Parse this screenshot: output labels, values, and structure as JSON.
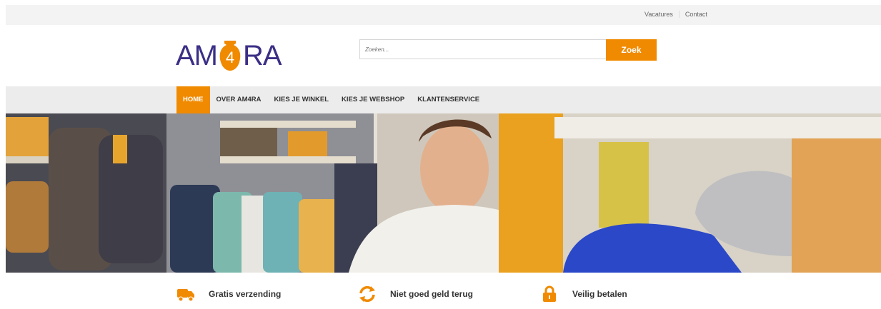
{
  "topbar": {
    "links": [
      "Vacatures",
      "Contact"
    ]
  },
  "logo": {
    "left": "AM",
    "mid": "4",
    "right": "RA"
  },
  "search": {
    "placeholder": "Zoeken...",
    "button": "Zoek"
  },
  "nav": {
    "items": [
      "HOME",
      "OVER AM4RA",
      "KIES JE WINKEL",
      "KIES JE WEBSHOP",
      "KLANTENSERVICE"
    ],
    "active": "HOME"
  },
  "hero": {
    "description": "Smiling young man in a clothing store folding blue sweaters"
  },
  "features": [
    {
      "icon": "truck-icon",
      "label": "Gratis verzending"
    },
    {
      "icon": "refresh-icon",
      "label": "Niet goed geld terug"
    },
    {
      "icon": "lock-icon",
      "label": "Veilig betalen"
    }
  ],
  "colors": {
    "accent": "#f08a00",
    "brand": "#3b2f86"
  }
}
